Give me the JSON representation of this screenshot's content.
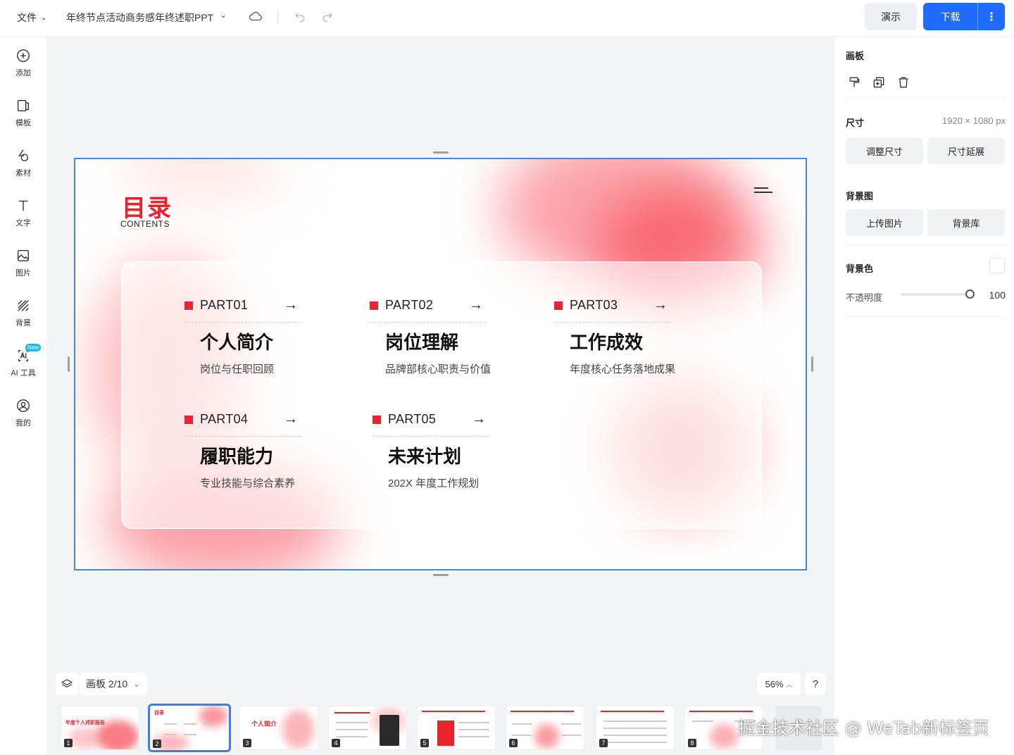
{
  "topbar": {
    "file_menu": "文件",
    "doc_title": "年终节点活动商务感年终述职PPT",
    "present": "演示",
    "download": "下载"
  },
  "sidebar": {
    "items": [
      {
        "label": "添加",
        "icon": "plus-circle-icon"
      },
      {
        "label": "模板",
        "icon": "template-icon"
      },
      {
        "label": "素材",
        "icon": "shapes-icon"
      },
      {
        "label": "文字",
        "icon": "text-icon"
      },
      {
        "label": "图片",
        "icon": "image-icon"
      },
      {
        "label": "背景",
        "icon": "background-icon"
      },
      {
        "label": "AI 工具",
        "icon": "ai-icon",
        "badge": "New"
      },
      {
        "label": "我的",
        "icon": "user-icon"
      }
    ]
  },
  "slide": {
    "title": "目录",
    "subtitle": "CONTENTS",
    "parts": [
      {
        "name": "PART01",
        "title": "个人简介",
        "desc": "岗位与任职回顾"
      },
      {
        "name": "PART02",
        "title": "岗位理解",
        "desc": "品牌部核心职责与价值"
      },
      {
        "name": "PART03",
        "title": "工作成效",
        "desc": "年度核心任务落地成果"
      },
      {
        "name": "PART04",
        "title": "履职能力",
        "desc": "专业技能与综合素养"
      },
      {
        "name": "PART05",
        "title": "未来计划",
        "desc": "202X 年度工作规划"
      }
    ],
    "arrow": "→"
  },
  "panel": {
    "section_board": "画板",
    "size_label": "尺寸",
    "size_value": "1920 × 1080 px",
    "resize": "调整尺寸",
    "extend": "尺寸延展",
    "bg_image_label": "背景图",
    "upload": "上传图片",
    "bg_library": "背景库",
    "bg_color_label": "背景色",
    "bg_color": "#ffffff",
    "opacity_label": "不透明度",
    "opacity_value": "100"
  },
  "bottom": {
    "page_label": "画板 2/10",
    "zoom": "56%",
    "help": "?",
    "thumbnails": [
      {
        "num": "1",
        "title": "年度个人述职报告"
      },
      {
        "num": "2",
        "title": "目录"
      },
      {
        "num": "3",
        "title": "个人简介"
      },
      {
        "num": "4",
        "title": ""
      },
      {
        "num": "5",
        "title": ""
      },
      {
        "num": "6",
        "title": ""
      },
      {
        "num": "7",
        "title": ""
      },
      {
        "num": "8",
        "title": ""
      }
    ]
  },
  "watermark": "掘金技术社区 @ WeTab新标签页",
  "colors": {
    "accent": "#1f6bff",
    "brand_red": "#e8232b",
    "selection": "#4a80f0"
  }
}
